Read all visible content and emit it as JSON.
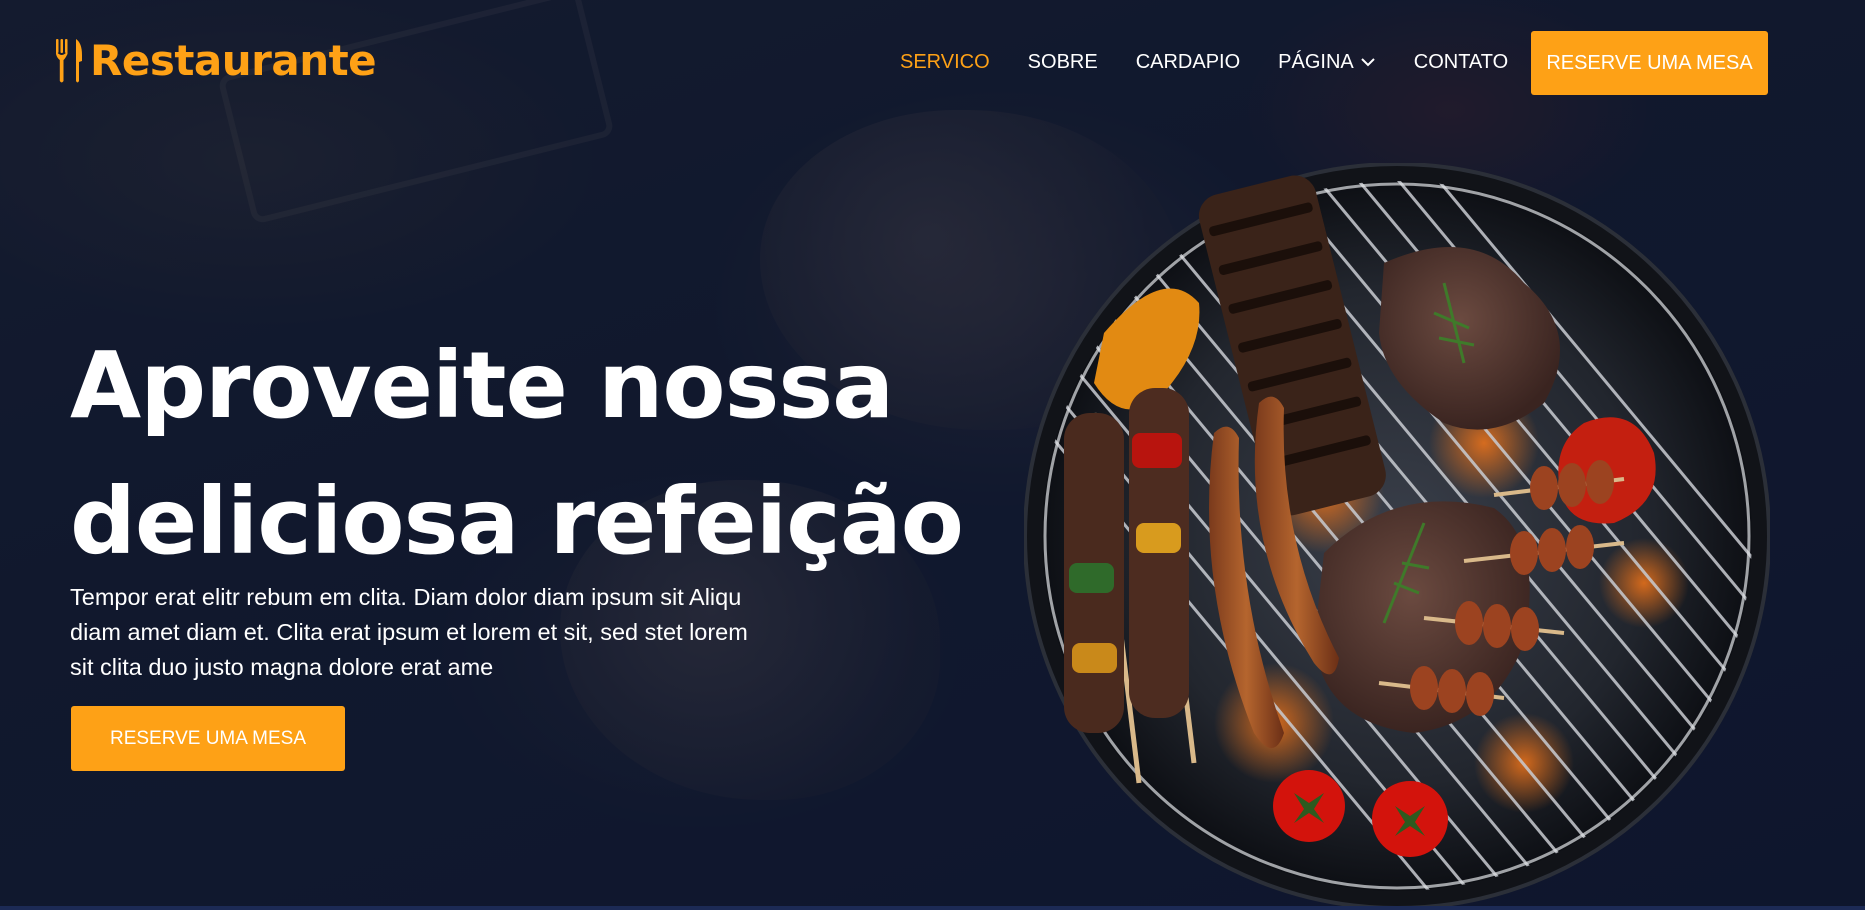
{
  "brand": {
    "name": "Restaurante",
    "icon": "utensils-icon",
    "color": "#fea116"
  },
  "nav": {
    "items": [
      {
        "label": "SERVICO",
        "active": true
      },
      {
        "label": "SOBRE",
        "active": false
      },
      {
        "label": "CARDAPIO",
        "active": false
      },
      {
        "label": "PÁGINA",
        "active": false,
        "dropdown": true
      },
      {
        "label": "CONTATO",
        "active": false
      }
    ],
    "cta_label": "RESERVE UMA MESA"
  },
  "hero": {
    "title_line1": "Aproveite nossa",
    "title_line2": "deliciosa refeição",
    "description": "Tempor erat elitr rebum em clita. Diam dolor diam ipsum sit Aliqu diam amet diam et. Clita erat ipsum et lorem et sit, sed stet lorem sit clita duo justo magna dolore erat ame",
    "cta_label": "RESERVE UMA MESA",
    "image": "barbecue-grill-image"
  },
  "colors": {
    "accent": "#fea116",
    "background": "#0f172b",
    "text": "#ffffff"
  }
}
